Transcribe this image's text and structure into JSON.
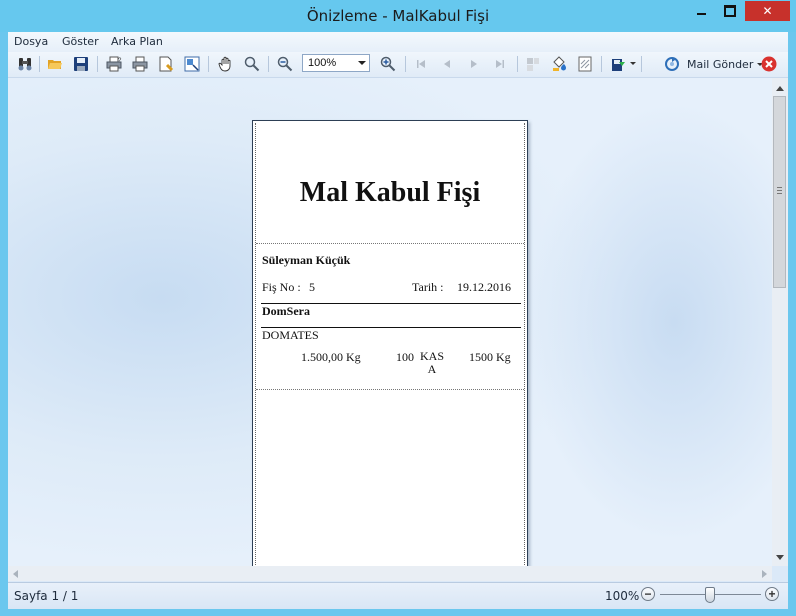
{
  "window": {
    "title": "Önizleme - MalKabul Fişi",
    "controls": {
      "minimize": "",
      "maximize": "",
      "close": "✕"
    }
  },
  "menu": {
    "items": [
      "Dosya",
      "Göster",
      "Arka Plan"
    ]
  },
  "toolbar": {
    "zoom_value": "100%",
    "mail_label": "Mail Gönder",
    "icons": [
      "find-icon",
      "open-icon",
      "save-icon",
      "print-dialog-icon",
      "print-icon",
      "page-setup-icon",
      "scale-icon",
      "hand-tool-icon",
      "magnifier-icon",
      "zoom-out-icon",
      "zoom-in-icon",
      "first-page-icon",
      "previous-page-icon",
      "next-page-icon",
      "last-page-icon",
      "multiple-pages-icon",
      "background-color-icon",
      "watermark-icon",
      "export-icon",
      "send-mail-icon",
      "close-preview-icon"
    ]
  },
  "document": {
    "title": "Mal Kabul Fişi",
    "person": "Süleyman Küçük",
    "fis_no_label": "Fiş No :",
    "fis_no": "5",
    "tarih_label": "Tarih :",
    "tarih": "19.12.2016",
    "company": "DomSera",
    "product": "DOMATES",
    "quantity": "1.500,00 Kg",
    "package_count": "100",
    "package_unit": "KASA",
    "net_weight": "1500 Kg"
  },
  "status": {
    "page_label": "Sayfa 1 / 1",
    "zoom_label": "100%",
    "zoom_out": "−",
    "zoom_in": "+",
    "zoom_level_percent": 100
  },
  "colors": {
    "titlebar": "#66c8ee",
    "close_button": "#c7312b",
    "canvas": "#dbe9f8"
  }
}
